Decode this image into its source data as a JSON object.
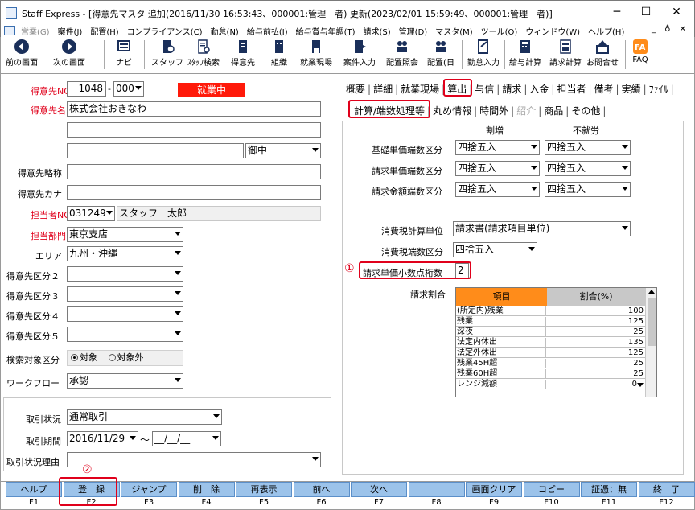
{
  "window": {
    "title": "Staff Express - [得意先マスタ 追加(2016/11/30 16:53:43、000001:管理　者) 更新(2023/02/01 15:59:49、000001:管理　者)]",
    "min": "─",
    "max": "☐",
    "close": "✕"
  },
  "menu": [
    "営業(G)",
    "案件(J)",
    "配置(H)",
    "コンプライアンス(C)",
    "勤怠(N)",
    "給与前払(I)",
    "給与賞与年調(T)",
    "請求(S)",
    "管理(D)",
    "マスタ(M)",
    "ツール(O)",
    "ウィンドウ(W)",
    "ヘルプ(H)"
  ],
  "mdi": "_ ♁ ✕",
  "toolbar": {
    "prev": "前の画面",
    "next": "次の画面",
    "navi": "ナビ",
    "staff": "スタッフ",
    "staff_search": "ｽﾀｯﾌ検索",
    "customer": "得意先",
    "org": "組織",
    "site": "就業現場",
    "case_input": "案件入力",
    "place_view": "配置照会",
    "place_day": "配置(日",
    "attendance": "勤怠入力",
    "salary_calc": "給与計算",
    "bill_calc": "請求計算",
    "inquiry": "お問合せ",
    "faq": "FAQ"
  },
  "left": {
    "customer_no_label": "得意先NO",
    "customer_no": "1048",
    "customer_branch": "000",
    "status": "就業中",
    "customer_name_label": "得意先名",
    "customer_name": "株式会社おきなわ",
    "honorific": "御中",
    "short_name_label": "得意先略称",
    "kana_label": "得意先カナ",
    "staff_no_label": "担当者NO",
    "staff_no": "031249",
    "staff_name": "スタッフ　太郎",
    "dept_label": "担当部門",
    "dept": "東京支店",
    "area_label": "エリア",
    "area": "九州・沖縄",
    "cat2_label": "得意先区分２",
    "cat3_label": "得意先区分３",
    "cat4_label": "得意先区分４",
    "cat5_label": "得意先区分５",
    "search_label": "検索対象区分",
    "search_on": "対象",
    "search_off": "対象外",
    "workflow_label": "ワークフロー",
    "workflow": "承認",
    "deal_status_label": "取引状況",
    "deal_status": "通常取引",
    "deal_period_label": "取引期間",
    "deal_from": "2016/11/29",
    "tilde": "～",
    "deal_to": "__/__/__",
    "deal_reason_label": "取引状況理由"
  },
  "right": {
    "tabs": [
      "概要",
      "詳細",
      "就業現場",
      "算出",
      "与信",
      "請求",
      "入金",
      "担当者",
      "備考",
      "実績",
      "ﾌｧｲﾙ"
    ],
    "subtabs": [
      "計算/端数処理等",
      "丸め情報",
      "時間外",
      "紹介",
      "商品",
      "その他"
    ],
    "col_hdr1": "割増",
    "col_hdr2": "不就労",
    "row1_label": "基礎単価端数区分",
    "row1_v1": "四捨五入",
    "row1_v2": "四捨五入",
    "row2_label": "請求単価端数区分",
    "row2_v1": "四捨五入",
    "row2_v2": "四捨五入",
    "row3_label": "請求金額端数区分",
    "row3_v1": "四捨五入",
    "row3_v2": "四捨五入",
    "tax_unit_label": "消費税計算単位",
    "tax_unit": "請求書(請求項目単位)",
    "tax_round_label": "消費税端数区分",
    "tax_round": "四捨五入",
    "decimal_label": "請求単価小数点桁数",
    "decimal": "2",
    "mark1": "①",
    "ratio_label": "請求割合",
    "grid_h1": "項目",
    "grid_h2": "割合(%)",
    "grid_rows": [
      {
        "item": "(所定内)残業",
        "val": "100"
      },
      {
        "item": "残業",
        "val": "125"
      },
      {
        "item": "深夜",
        "val": "25"
      },
      {
        "item": "法定内休出",
        "val": "135"
      },
      {
        "item": "法定外休出",
        "val": "125"
      },
      {
        "item": "残業45H超",
        "val": "25"
      },
      {
        "item": "残業60H超",
        "val": "25"
      },
      {
        "item": "レンジ減額",
        "val": "0"
      }
    ]
  },
  "mark2": "②",
  "fkeys": [
    {
      "label": "ヘルプ",
      "key": "F1"
    },
    {
      "label": "登　録",
      "key": "F2"
    },
    {
      "label": "ジャンプ",
      "key": "F3"
    },
    {
      "label": "削　除",
      "key": "F4"
    },
    {
      "label": "再表示",
      "key": "F5"
    },
    {
      "label": "前へ",
      "key": "F6"
    },
    {
      "label": "次へ",
      "key": "F7"
    },
    {
      "label": "",
      "key": "F8"
    },
    {
      "label": "画面クリア",
      "key": "F9"
    },
    {
      "label": "コピー",
      "key": "F10"
    },
    {
      "label": "証憑：無",
      "key": "F11"
    },
    {
      "label": "終　了",
      "key": "F12"
    }
  ]
}
